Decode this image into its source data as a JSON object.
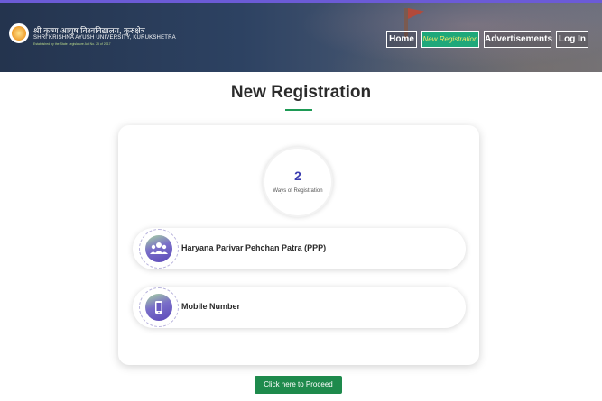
{
  "header": {
    "logo_line1": "श्री कृष्ण आयुष विश्वविद्यालय, कुरुक्षेत्र",
    "logo_line2": "SHRI KRISHNA AYUSH UNIVERSITY, KURUKSHETRA",
    "logo_line3": "Established by the State Legislature Act No. 25 of 2017"
  },
  "nav": {
    "home": "Home",
    "new_registration": "New Registration",
    "advertisements": "Advertisements",
    "login": "Log In"
  },
  "main": {
    "title": "New Registration",
    "ways_count": "2",
    "ways_label": "Ways of Registration",
    "options": [
      {
        "label": "Haryana Parivar Pehchan Patra (PPP)",
        "icon": "family-icon"
      },
      {
        "label": "Mobile Number",
        "icon": "mobile-icon"
      }
    ],
    "proceed_label": "Click here to Proceed"
  },
  "colors": {
    "accent_green": "#1e8a4c",
    "active_nav": "#1fa87a",
    "count_color": "#3b3db0"
  }
}
